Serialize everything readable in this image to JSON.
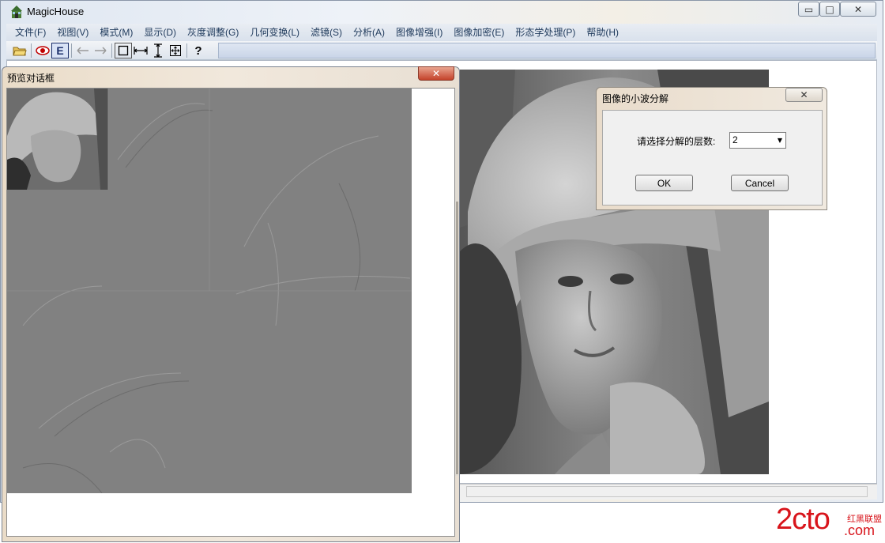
{
  "window": {
    "title": "MagicHouse",
    "minimize_glyph": "▭",
    "maximize_glyph": "□",
    "close_glyph": "✕"
  },
  "menu": [
    {
      "label": "文件(F)"
    },
    {
      "label": "视图(V)"
    },
    {
      "label": "模式(M)"
    },
    {
      "label": "显示(D)"
    },
    {
      "label": "灰度调整(G)"
    },
    {
      "label": "几何变换(L)"
    },
    {
      "label": "滤镜(S)"
    },
    {
      "label": "分析(A)"
    },
    {
      "label": "图像增强(I)"
    },
    {
      "label": "图像加密(E)"
    },
    {
      "label": "形态学处理(P)"
    },
    {
      "label": "帮助(H)"
    }
  ],
  "toolbar": {
    "icons": [
      "open-folder-icon",
      "eye-icon",
      "e-icon",
      "arrow-left-icon",
      "arrow-right-icon",
      "select-rect-icon",
      "measure-horizontal-icon",
      "measure-vertical-icon",
      "fit-icon",
      "help-icon"
    ],
    "e_glyph": "E",
    "help_glyph": "?"
  },
  "preview_dialog": {
    "title": "预览对话框",
    "close_glyph": "✕"
  },
  "wavelet_dialog": {
    "title": "图像的小波分解",
    "close_glyph": "✕",
    "level_label": "请选择分解的层数:",
    "level_value": "2",
    "ok_label": "OK",
    "cancel_label": "Cancel"
  },
  "watermark": {
    "brand": "2cto",
    "suffix": ".com",
    "tagline": "红黑联盟"
  },
  "colors": {
    "menu_text": "#1e395b",
    "watermark_red": "#d8141b",
    "close_red": "#c4432b"
  }
}
